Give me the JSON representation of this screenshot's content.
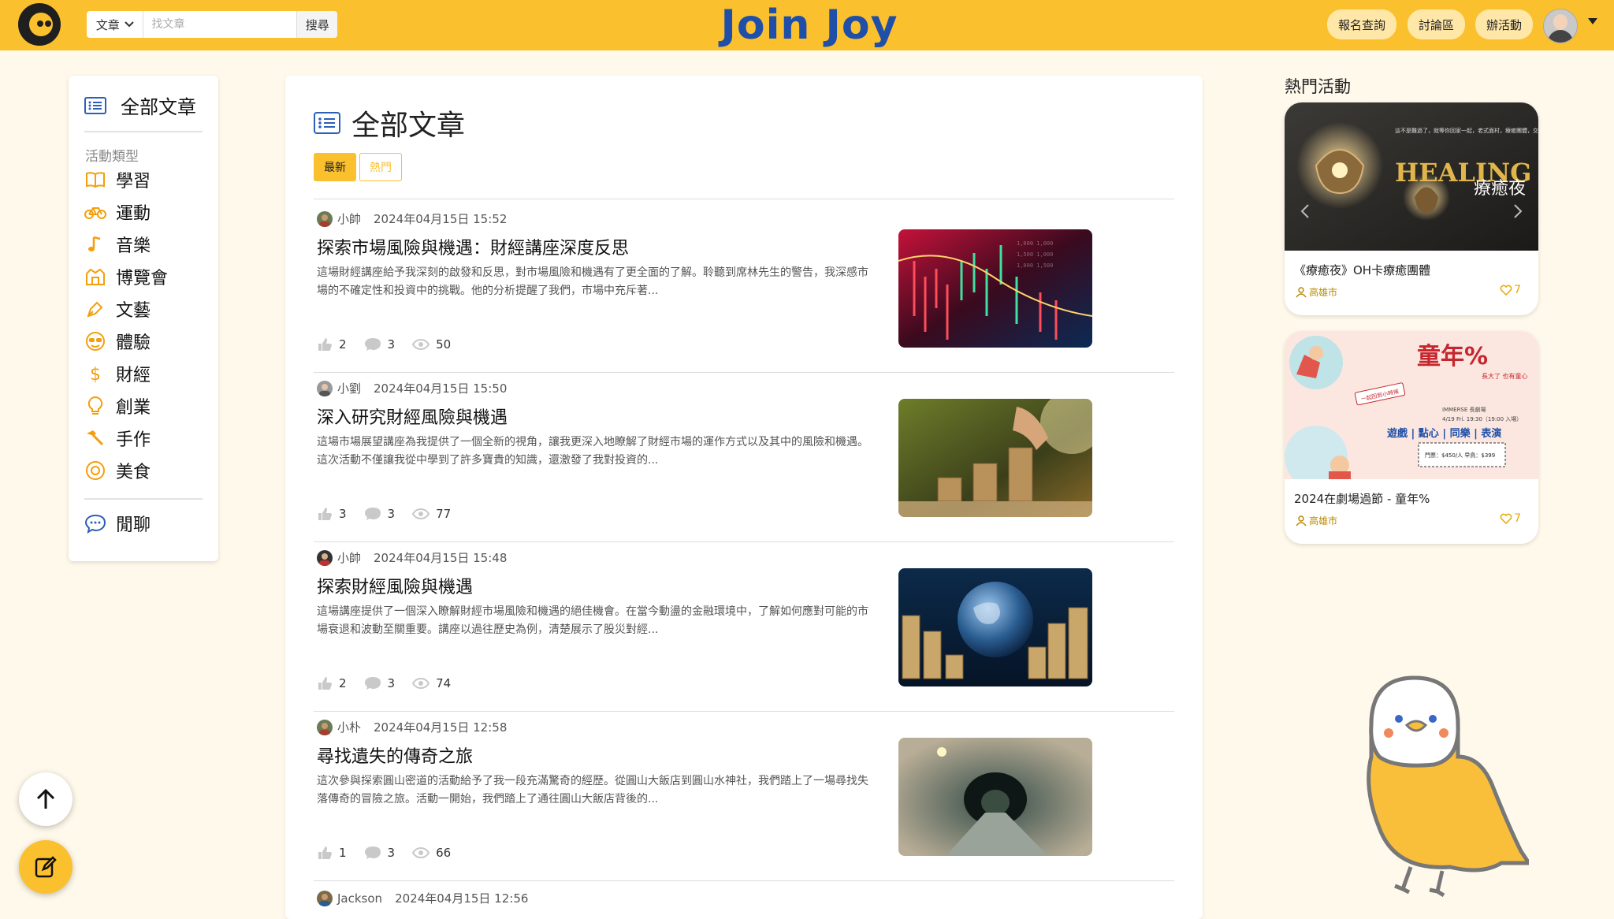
{
  "header": {
    "brand": "Join Joy",
    "search_category": "文章",
    "search_placeholder": "找文章",
    "search_button": "搜尋",
    "nav": [
      "報名查詢",
      "討論區",
      "辦活動"
    ]
  },
  "sidebar": {
    "title": "全部文章",
    "section_label": "活動類型",
    "categories": [
      {
        "label": "學習",
        "icon": "book-icon"
      },
      {
        "label": "運動",
        "icon": "bicycle-icon"
      },
      {
        "label": "音樂",
        "icon": "music-note-icon"
      },
      {
        "label": "博覽會",
        "icon": "building-icon"
      },
      {
        "label": "文藝",
        "icon": "pen-nib-icon"
      },
      {
        "label": "體驗",
        "icon": "sunglasses-face-icon"
      },
      {
        "label": "財經",
        "icon": "dollar-icon"
      },
      {
        "label": "創業",
        "icon": "lightbulb-icon"
      },
      {
        "label": "手作",
        "icon": "hammer-icon"
      },
      {
        "label": "美食",
        "icon": "food-icon"
      }
    ],
    "chat": {
      "label": "閒聊",
      "icon": "chat-bubble-icon"
    }
  },
  "main": {
    "title": "全部文章",
    "tabs": [
      {
        "label": "最新",
        "active": true
      },
      {
        "label": "熱門",
        "active": false
      }
    ],
    "posts": [
      {
        "author": "小帥",
        "date": "2024年04月15日 15:52",
        "title": "探索市場風險與機遇：財經講座深度反思",
        "excerpt": "這場財經講座給予我深刻的啟發和反思，對市場風險和機遇有了更全面的了解。聆聽到席林先生的警告，我深感市場的不確定性和投資中的挑戰。他的分析提醒了我們，市場中充斥著...",
        "likes": "2",
        "comments": "3",
        "views": "50",
        "image": "stock-chart-image"
      },
      {
        "author": "小劉",
        "date": "2024年04月15日 15:50",
        "title": "深入研究財經風險與機遇",
        "excerpt": "這場市場展望講座為我提供了一個全新的視角，讓我更深入地瞭解了財經市場的運作方式以及其中的風險和機遇。這次活動不僅讓我從中學到了許多寶貴的知識，還激發了我對投資的...",
        "likes": "3",
        "comments": "3",
        "views": "77",
        "image": "coin-stacks-image"
      },
      {
        "author": "小帥",
        "date": "2024年04月15日 15:48",
        "title": "探索財經風險與機遇",
        "excerpt": "這場講座提供了一個深入瞭解財經市場風險和機遇的絕佳機會。在當今動盪的金融環境中，了解如何應對可能的市場衰退和波動至關重要。講座以過往歷史為例，清楚展示了股災對經...",
        "likes": "2",
        "comments": "3",
        "views": "74",
        "image": "globe-coins-image"
      },
      {
        "author": "小朴",
        "date": "2024年04月15日 12:58",
        "title": "尋找遺失的傳奇之旅",
        "excerpt": "這次參與探索圓山密道的活動給予了我一段充滿驚奇的經歷。從圓山大飯店到圓山水神社，我們踏上了一場尋找失落傳奇的冒險之旅。活動一開始，我們踏上了通往圓山大飯店背後的...",
        "likes": "1",
        "comments": "3",
        "views": "66",
        "image": "tunnel-image"
      },
      {
        "author": "Jackson",
        "date": "2024年04月15日 12:56"
      }
    ]
  },
  "hot_events": {
    "title": "熱門活動",
    "events": [
      {
        "title": "《療癒夜》OH卡療癒團體",
        "location": "高雄市",
        "likes": "7",
        "banner_caption": "這不是難過了，就等你回家一起，老式面村，療癒團體，交換世",
        "banner_text_en": "HEALING NIGHT",
        "banner_text_zh": "療癒夜"
      },
      {
        "title": "2024在劇場過節 - 童年%",
        "location": "高雄市",
        "likes": "7",
        "banner_heading": "童年%",
        "banner_subheading": "長大了 也有童心",
        "banner_line": "遊戲 | 點心 | 同樂 | 表演",
        "banner_date": "4/19 Fri. 19:30（19:00 入場）",
        "banner_price": "門票：$450/人 早鳥：$399",
        "banner_venue": "IMMERSE 長劇場",
        "banner_tag": "一起回到小時候"
      }
    ]
  },
  "colors": {
    "brand_yellow": "#FBC02D",
    "brand_blue": "#1F4FA8",
    "icon_orange": "#F59E0B",
    "page_bg": "#FFF9EB"
  }
}
